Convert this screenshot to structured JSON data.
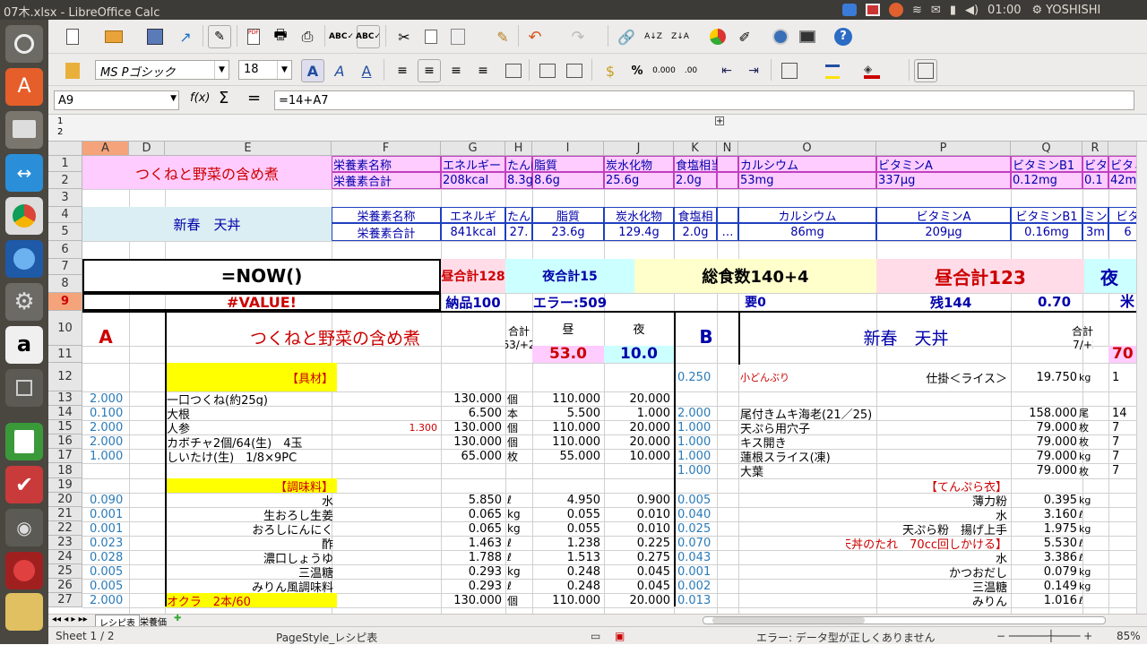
{
  "window": {
    "title": "07木.xlsx - LibreOffice Calc",
    "clock": "01:00",
    "user": "YOSHISHI"
  },
  "toolbar": {
    "font_name": "MS Pゴシック",
    "font_size": "18"
  },
  "formula_bar": {
    "cell_ref": "A9",
    "formula": "=14+A7",
    "fx": "f(x)",
    "sigma": "Σ",
    "equals": "="
  },
  "columns": [
    "A",
    "D",
    "E",
    "F",
    "G",
    "H",
    "I",
    "J",
    "K",
    "N",
    "O",
    "P",
    "Q",
    "R"
  ],
  "rows": [
    "1",
    "2",
    "3",
    "4",
    "5",
    "6",
    "7",
    "8",
    "9",
    "10",
    "11",
    "12",
    "13",
    "14",
    "15",
    "16",
    "17",
    "18",
    "19",
    "20",
    "21",
    "22",
    "23",
    "24",
    "25",
    "26",
    "27"
  ],
  "top": {
    "dish1": "つくねと野菜の含め煮",
    "dish2": "新春　天丼",
    "nut_labels1": [
      "栄養素名称",
      "エネルギー",
      "たんぱく",
      "脂質",
      "炭水化物",
      "食塩相当",
      "",
      "カルシウム",
      "ビタミンA",
      "ビタミンB1",
      "ビタミ",
      "ビタミ"
    ],
    "nut_vals1": [
      "栄養素合計",
      "208kcal",
      "8.3g",
      "8.6g",
      "25.6g",
      "2.0g",
      "",
      "53mg",
      "337μg",
      "0.12mg",
      "0.1",
      "42m"
    ],
    "nut_labels2": [
      "栄養素名称",
      "エネルギ",
      "たん",
      "脂質",
      "炭水化物",
      "食塩相",
      "",
      "カルシウム",
      "ビタミンA",
      "ビタミンB1",
      "ミン",
      "ビタ"
    ],
    "nut_vals2": [
      "栄養素合計",
      "841kcal",
      "27.",
      "23.6g",
      "129.4g",
      "2.0g",
      "…",
      "86mg",
      "209μg",
      "0.16mg",
      "3m",
      "6"
    ],
    "now": "=NOW()",
    "lunch128": "昼合計128",
    "dinner15": "夜合計15",
    "total": "総食数140+4",
    "lunch123": "昼合計123",
    "night": "夜",
    "value_err": "#VALUE!",
    "delivery": "納品100",
    "error509": "エラー:509",
    "need0": "要0",
    "remain144": "残144",
    "ratio": "0.70",
    "rice": "米"
  },
  "section": {
    "a_label": "A",
    "b_label": "B",
    "title_a": "つくねと野菜の含め煮",
    "title_b": "新春　天丼",
    "sum_a": "合計63/+2",
    "sum_b": "合計77/+2",
    "hiru": "昼",
    "yoru": "夜",
    "hiru_val": "53.0",
    "yoru_val": "10.0",
    "b_val": "70"
  },
  "left_rows": [
    {
      "a": "",
      "e": "【具材】",
      "g": "",
      "h": "",
      "i": "",
      "j": "",
      "k": "0.250"
    },
    {
      "a": "2.000",
      "e": "一口つくね(約25g)",
      "g": "130.000",
      "h": "個",
      "i": "110.000",
      "j": "20.000",
      "k": ""
    },
    {
      "a": "0.100",
      "e": "大根",
      "g": "6.500",
      "h": "本",
      "i": "5.500",
      "j": "1.000",
      "k": "2.000"
    },
    {
      "a": "2.000",
      "e": "人参",
      "f": "1.300",
      "g": "130.000",
      "h": "個",
      "i": "110.000",
      "j": "20.000",
      "k": "1.000"
    },
    {
      "a": "2.000",
      "e": "カボチャ2個/64(生)　4玉",
      "g": "130.000",
      "h": "個",
      "i": "110.000",
      "j": "20.000",
      "k": "1.000"
    },
    {
      "a": "1.000",
      "e": "しいたけ(生)　1/8×9PC",
      "g": "65.000",
      "h": "枚",
      "i": "55.000",
      "j": "10.000",
      "k": "1.000"
    },
    {
      "a": "",
      "e": "",
      "g": "",
      "h": "",
      "i": "",
      "j": "",
      "k": "1.000"
    },
    {
      "a": "",
      "e": "【調味料】",
      "g": "",
      "h": "",
      "i": "",
      "j": "",
      "k": ""
    },
    {
      "a": "0.090",
      "e": "水",
      "g": "5.850",
      "h": "ℓ",
      "i": "4.950",
      "j": "0.900",
      "k": "0.005"
    },
    {
      "a": "0.001",
      "e": "生おろし生姜",
      "g": "0.065",
      "h": "kg",
      "i": "0.055",
      "j": "0.010",
      "k": "0.040"
    },
    {
      "a": "0.001",
      "e": "おろしにんにく",
      "g": "0.065",
      "h": "kg",
      "i": "0.055",
      "j": "0.010",
      "k": "0.025"
    },
    {
      "a": "0.023",
      "e": "酢",
      "g": "1.463",
      "h": "ℓ",
      "i": "1.238",
      "j": "0.225",
      "k": "0.070"
    },
    {
      "a": "0.028",
      "e": "濃口しょうゆ",
      "g": "1.788",
      "h": "ℓ",
      "i": "1.513",
      "j": "0.275",
      "k": "0.043"
    },
    {
      "a": "0.005",
      "e": "三温糖",
      "g": "0.293",
      "h": "kg",
      "i": "0.248",
      "j": "0.045",
      "k": "0.001"
    },
    {
      "a": "0.005",
      "e": "みりん風調味料",
      "g": "0.293",
      "h": "ℓ",
      "i": "0.248",
      "j": "0.045",
      "k": "0.002"
    },
    {
      "a": "2.000",
      "e": "オクラ　2本/60",
      "g": "130.000",
      "h": "個",
      "i": "110.000",
      "j": "20.000",
      "k": "0.013"
    }
  ],
  "right_rows": [
    {
      "o": "小どんぶり",
      "p": "仕掛＜ライス＞",
      "q": "19.750",
      "u": "kg",
      "r": "1"
    },
    {
      "o": "",
      "p": "",
      "q": "",
      "u": "",
      "r": ""
    },
    {
      "o": "尾付きムキ海老(21／25)",
      "p": "",
      "q": "158.000",
      "u": "尾",
      "r": "14"
    },
    {
      "o": "天ぷら用穴子",
      "p": "",
      "q": "79.000",
      "u": "枚",
      "r": "7"
    },
    {
      "o": "キス開き",
      "p": "",
      "q": "79.000",
      "u": "枚",
      "r": "7"
    },
    {
      "o": "蓮根スライス(凍)",
      "p": "",
      "q": "79.000",
      "u": "kg",
      "r": "7"
    },
    {
      "o": "大葉",
      "p": "",
      "q": "79.000",
      "u": "枚",
      "r": "7"
    },
    {
      "o": "",
      "p": "【てんぷら衣】",
      "q": "",
      "u": "",
      "r": ""
    },
    {
      "o": "",
      "p": "薄力粉",
      "q": "0.395",
      "u": "kg",
      "r": ""
    },
    {
      "o": "",
      "p": "水",
      "q": "3.160",
      "u": "ℓ",
      "r": ""
    },
    {
      "o": "",
      "p": "天ぷら粉　揚げ上手",
      "q": "1.975",
      "u": "kg",
      "r": ""
    },
    {
      "o": "",
      "p": "【天丼のたれ　70cc回しかける】",
      "q": "5.530",
      "u": "ℓ",
      "r": ""
    },
    {
      "o": "",
      "p": "水",
      "q": "3.386",
      "u": "ℓ",
      "r": ""
    },
    {
      "o": "",
      "p": "かつおだし",
      "q": "0.079",
      "u": "kg",
      "r": ""
    },
    {
      "o": "",
      "p": "三温糖",
      "q": "0.149",
      "u": "kg",
      "r": ""
    },
    {
      "o": "",
      "p": "みりん",
      "q": "1.016",
      "u": "ℓ",
      "r": ""
    }
  ],
  "tabs": [
    "レシピ表",
    "栄養価"
  ],
  "status": {
    "sheet": "Sheet 1 / 2",
    "style": "PageStyle_レシピ表",
    "error": "エラー: データ型が正しくありません",
    "zoom": "85%"
  },
  "colors": {
    "pink": "#ffccff",
    "lightblue": "#dbeef3",
    "yellow": "#ffff00",
    "cyan": "#ccffff",
    "lightyellow": "#ffffcc",
    "red": "#ff0000",
    "blue": "#0000cc"
  }
}
